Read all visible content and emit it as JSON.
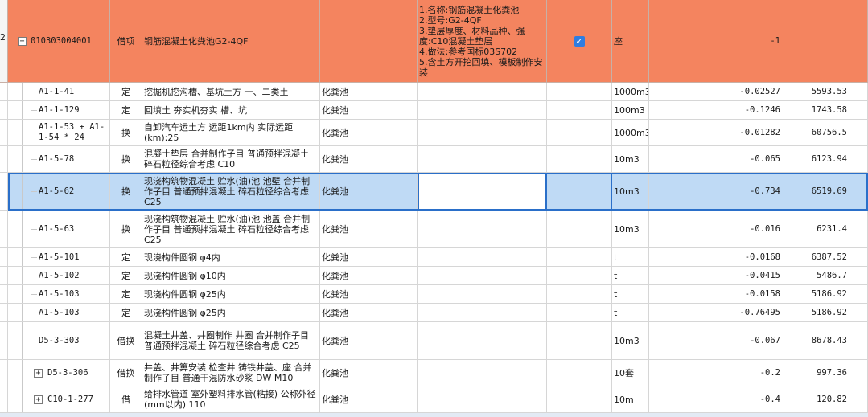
{
  "parent": {
    "row_number": "2",
    "code": "010303004001",
    "type": "借项",
    "name": "钢筋混凝土化粪池G2-4QF",
    "features": [
      "1.名称:钢筋混凝土化粪池",
      "2.型号:G2-4QF",
      "3.垫层厚度、材料品种、强度:C10混凝土垫层",
      "4.做法:参考国标03S702",
      "5.含土方开挖回填、模板制作安装"
    ],
    "checked": true,
    "unit": "座",
    "quantity": "-1",
    "price": ""
  },
  "rows": [
    {
      "code": "A1-1-41",
      "type": "定",
      "name": "挖掘机挖沟槽、基坑土方 一、二类土",
      "part": "化粪池",
      "unit": "1000m3",
      "quantity": "-0.02527",
      "price": "5593.53"
    },
    {
      "code": "A1-1-129",
      "type": "定",
      "name": "回填土 夯实机夯实 槽、坑",
      "part": "化粪池",
      "unit": "100m3",
      "quantity": "-0.1246",
      "price": "1743.58"
    },
    {
      "code": "A1-1-53 + A1-1-54 * 24",
      "type": "换",
      "name": "自卸汽车运土方 运距1km内  实际运距(km):25",
      "part": "化粪池",
      "unit": "1000m3",
      "quantity": "-0.01282",
      "price": "60756.5"
    },
    {
      "code": "A1-5-78",
      "type": "换",
      "name": "混凝土垫层  合并制作子目 普通预拌混凝土 碎石粒径综合考虑 C10",
      "part": "化粪池",
      "unit": "10m3",
      "quantity": "-0.065",
      "price": "6123.94"
    },
    {
      "code": "A1-5-62",
      "type": "换",
      "name": "现浇构筑物混凝土 贮水(油)池 池壁  合并制作子目 普通预拌混凝土 碎石粒径综合考虑 C25",
      "part": "化粪池",
      "unit": "10m3",
      "quantity": "-0.734",
      "price": "6519.69"
    },
    {
      "code": "A1-5-63",
      "type": "换",
      "name": "现浇构筑物混凝土 贮水(油)池 池盖  合并制作子目 普通预拌混凝土 碎石粒径综合考虑 C25",
      "part": "化粪池",
      "unit": "10m3",
      "quantity": "-0.016",
      "price": "6231.4"
    },
    {
      "code": "A1-5-101",
      "type": "定",
      "name": "现浇构件圆钢 φ4内",
      "part": "化粪池",
      "unit": "t",
      "quantity": "-0.0168",
      "price": "6387.52"
    },
    {
      "code": "A1-5-102",
      "type": "定",
      "name": "现浇构件圆钢 φ10内",
      "part": "化粪池",
      "unit": "t",
      "quantity": "-0.0415",
      "price": "5486.7"
    },
    {
      "code": "A1-5-103",
      "type": "定",
      "name": "现浇构件圆钢 φ25内",
      "part": "化粪池",
      "unit": "t",
      "quantity": "-0.0158",
      "price": "5186.92"
    },
    {
      "code": "A1-5-103",
      "type": "定",
      "name": "现浇构件圆钢 φ25内",
      "part": "化粪池",
      "unit": "t",
      "quantity": "-0.76495",
      "price": "5186.92"
    },
    {
      "code": "D5-3-303",
      "type": "借换",
      "name": "混凝土井盖、井圈制作 井圈  合并制作子目 普通预拌混凝土 碎石粒径综合考虑 C25",
      "part": "化粪池",
      "unit": "10m3",
      "quantity": "-0.067",
      "price": "8678.43"
    },
    {
      "code": "D5-3-306",
      "type": "借换",
      "name": "井盖、井箅安装 检查井 铸铁井盖、座  合并制作子目 普通干混防水砂浆 DW M10",
      "part": "化粪池",
      "unit": "10套",
      "quantity": "-0.2",
      "price": "997.36"
    },
    {
      "code": "C10-1-277",
      "type": "借",
      "name": "给排水管道 室外塑料排水管(粘接) 公称外径(mm以内) 110",
      "part": "化粪池",
      "unit": "10m",
      "quantity": "-0.4",
      "price": "120.82"
    }
  ],
  "colors": {
    "header_row": "#f4845f",
    "selected_row": "#bfdaf5",
    "selection_border": "#2a6fc9",
    "checkbox": "#2f7de1"
  },
  "icons": {
    "expand": "plus-box-icon",
    "collapse": "minus-box-icon",
    "check": "checkmark-icon"
  }
}
